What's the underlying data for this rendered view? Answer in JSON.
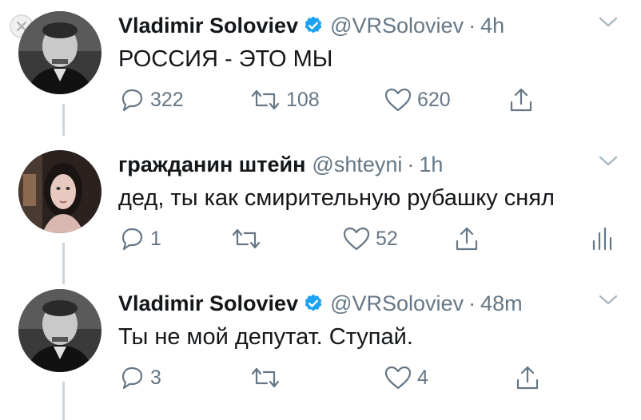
{
  "tweets": [
    {
      "name": "Vladimir Soloviev",
      "handle": "@VRSoloviev",
      "separator": "·",
      "time": "4h",
      "verified": true,
      "text": "РОССИЯ - ЭТО МЫ",
      "reply_count": "322",
      "retweet_count": "108",
      "like_count": "620"
    },
    {
      "name": "гражданин штейн",
      "handle": "@shteyni",
      "separator": "·",
      "time": "1h",
      "verified": false,
      "text": "дед, ты как смирительную рубашку снял",
      "reply_count": "1",
      "retweet_count": "",
      "like_count": "52"
    },
    {
      "name": "Vladimir Soloviev",
      "handle": "@VRSoloviev",
      "separator": "·",
      "time": "48m",
      "verified": true,
      "text": "Ты не мой депутат. Ступай.",
      "reply_count": "3",
      "retweet_count": "",
      "like_count": "4"
    }
  ],
  "colors": {
    "text": "#14171a",
    "muted": "#657786",
    "verified": "#1da1f2",
    "thread_line": "#ccd6dd"
  },
  "icons": [
    "close-icon",
    "verified-badge-icon",
    "chevron-down-icon",
    "reply-icon",
    "retweet-icon",
    "like-icon",
    "share-icon",
    "analytics-icon"
  ]
}
